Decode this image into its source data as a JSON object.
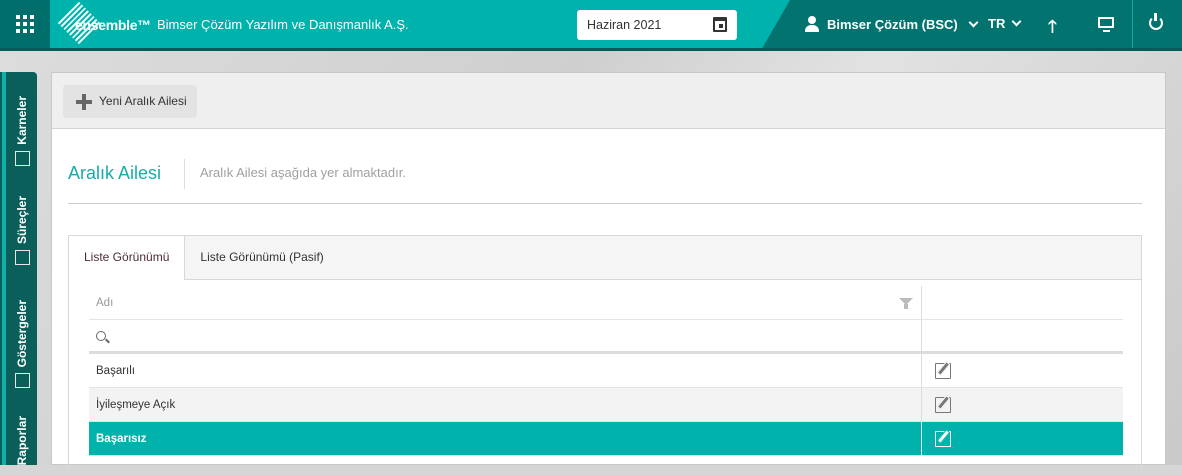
{
  "header": {
    "brand": "ensemble™",
    "company": "Bimser Çözüm Yazılım ve Danışmanlık A.Ş.",
    "date": "Haziran 2021",
    "user": "Bimser Çözüm (BSC)",
    "language": "TR"
  },
  "sidebar": {
    "items": [
      {
        "label": "Karneler"
      },
      {
        "label": "Süreçler"
      },
      {
        "label": "Göstergeler"
      },
      {
        "label": "Raporlar"
      }
    ]
  },
  "toolbar": {
    "new_label": "Yeni Aralık Ailesi"
  },
  "page": {
    "title": "Aralık Ailesi",
    "subtitle": "Aralık Ailesi aşağıda yer almaktadır."
  },
  "tabs": [
    {
      "label": "Liste Görünümü"
    },
    {
      "label": "Liste Görünümü (Pasif)"
    }
  ],
  "table": {
    "column": "Adı",
    "rows": [
      {
        "name": "Başarılı"
      },
      {
        "name": "İyileşmeye Açık"
      },
      {
        "name": "Başarısız"
      }
    ]
  },
  "colors": {
    "accent": "#00b2ac",
    "dark": "#02736f"
  }
}
